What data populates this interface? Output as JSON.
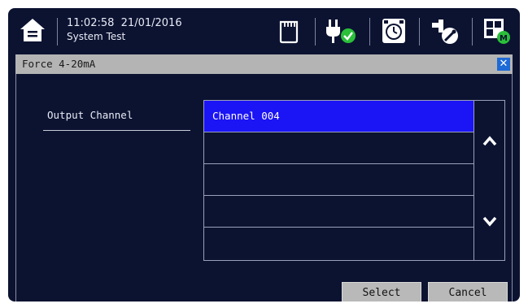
{
  "header": {
    "time": "11:02:58",
    "date": "21/01/2016",
    "subtitle": "System Test",
    "icons": [
      "home-icon",
      "memory-card-icon",
      "power-ok-icon",
      "alarm-clock-icon",
      "wrench-settings-icon",
      "modules-icon"
    ]
  },
  "dialog": {
    "title": "Force 4-20mA",
    "close_icon": "close-icon",
    "field_label": "Output Channel",
    "list_items": [
      "Channel 004",
      "",
      "",
      "",
      ""
    ],
    "selected_index": 0,
    "buttons": {
      "select": "Select",
      "cancel": "Cancel"
    }
  },
  "colors": {
    "background": "#0c1331",
    "selection": "#1b14f5",
    "titlebar": "#b4b4b4",
    "ok_green": "#2bbf3a"
  }
}
